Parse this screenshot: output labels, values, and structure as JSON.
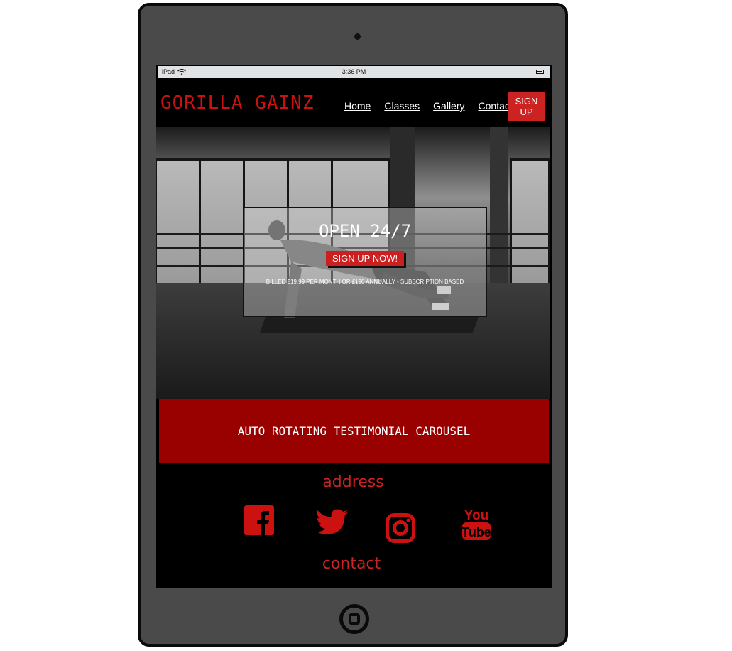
{
  "status_bar": {
    "device": "iPad",
    "time": "3:36 PM"
  },
  "nav": {
    "logo": "GORILLA GAINZ",
    "links": [
      "Home",
      "Classes",
      "Gallery",
      "Contact"
    ],
    "signup": "SIGN UP"
  },
  "hero": {
    "heading": "OPEN 24/7",
    "cta": "SIGN UP NOW!",
    "billing": "BILLED £19.99 PER MONTH OR £190 ANNUALLY - SUBSCRIPTION BASED"
  },
  "testimonial": {
    "text": "AUTO ROTATING TESTIMONIAL CAROUSEL"
  },
  "footer": {
    "address": "address",
    "contact": "contact",
    "social": [
      "facebook-icon",
      "twitter-icon",
      "instagram-icon",
      "youtube-icon"
    ],
    "accent_color": "#cc2222"
  },
  "colors": {
    "brand_red": "#cc1111",
    "testimonial_bg": "#990000",
    "device_frame": "#4a4a4a"
  }
}
